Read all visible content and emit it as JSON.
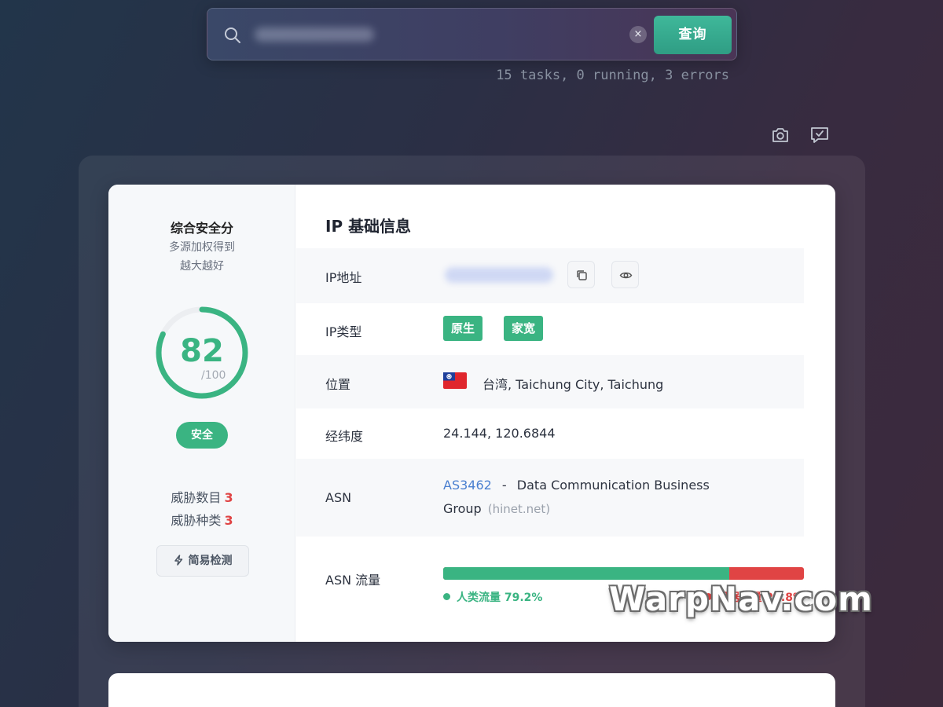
{
  "search": {
    "placeholder": "",
    "value": "",
    "clear_label": "×",
    "submit_label": "查询"
  },
  "status": {
    "tasks_text": "15 tasks, 0 running, 3 errors"
  },
  "toolbar": {
    "icons": [
      "camera-icon",
      "feedback-icon"
    ]
  },
  "score": {
    "title": "综合安全分",
    "subtitle_line1": "多源加权得到",
    "subtitle_line2": "越大越好",
    "value": "82",
    "max_label": "/100",
    "fraction": 0.82,
    "badge": "安全",
    "threat_count_label": "威胁数目",
    "threat_count": "3",
    "threat_types_label": "威胁种类",
    "threat_types": "3",
    "simple_check_label": "简易检测"
  },
  "ip_info": {
    "title": "IP 基础信息",
    "rows": {
      "ip_address": {
        "label": "IP地址",
        "value": ""
      },
      "ip_type": {
        "label": "IP类型",
        "tags": [
          "原生",
          "家宽"
        ]
      },
      "location": {
        "label": "位置",
        "value": "台湾, Taichung City, Taichung",
        "flag": "taiwan-flag"
      },
      "coordinates": {
        "label": "经纬度",
        "value": "24.144, 120.6844"
      },
      "asn": {
        "label": "ASN",
        "number": "AS3462",
        "separator": "-",
        "org_line1": "Data Communication Business",
        "org_line2": "Group",
        "host": "(hinet.net)"
      },
      "asn_traffic": {
        "label": "ASN 流量",
        "human_label": "人类流量 79.2%",
        "bot_label": "机器流量 20.8%",
        "human_percent": 79.2,
        "bot_percent": 20.8
      }
    }
  },
  "watermark": "WarpNav.com",
  "colors": {
    "accent_green": "#3ab482",
    "danger_red": "#e04444",
    "link_blue": "#4a7fd0"
  }
}
